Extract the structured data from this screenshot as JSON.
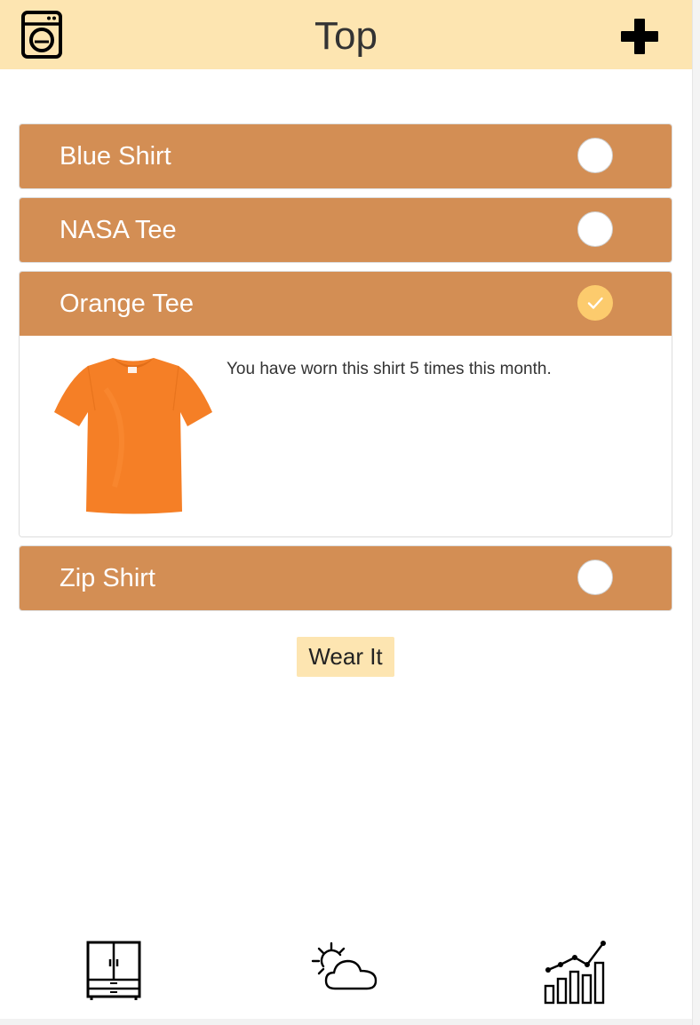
{
  "header": {
    "title": "Top",
    "left_icon": "washing-machine-icon",
    "right_icon": "plus-icon"
  },
  "items": [
    {
      "name": "Blue Shirt",
      "selected": false
    },
    {
      "name": "NASA Tee",
      "selected": false
    },
    {
      "name": "Orange Tee",
      "selected": true,
      "expanded": true,
      "description": "You have worn this shirt 5 times this month.",
      "image": "orange-tshirt"
    },
    {
      "name": "Zip Shirt",
      "selected": false
    }
  ],
  "actions": {
    "wear_label": "Wear It"
  },
  "bottom_nav": [
    {
      "icon": "wardrobe-icon"
    },
    {
      "icon": "weather-icon"
    },
    {
      "icon": "stats-chart-icon"
    }
  ],
  "colors": {
    "header_bg": "#fde5b1",
    "item_bg": "#d38e54",
    "selected_check": "#fccb6d",
    "button_bg": "#fde5b1",
    "shirt": "#f57f26"
  }
}
